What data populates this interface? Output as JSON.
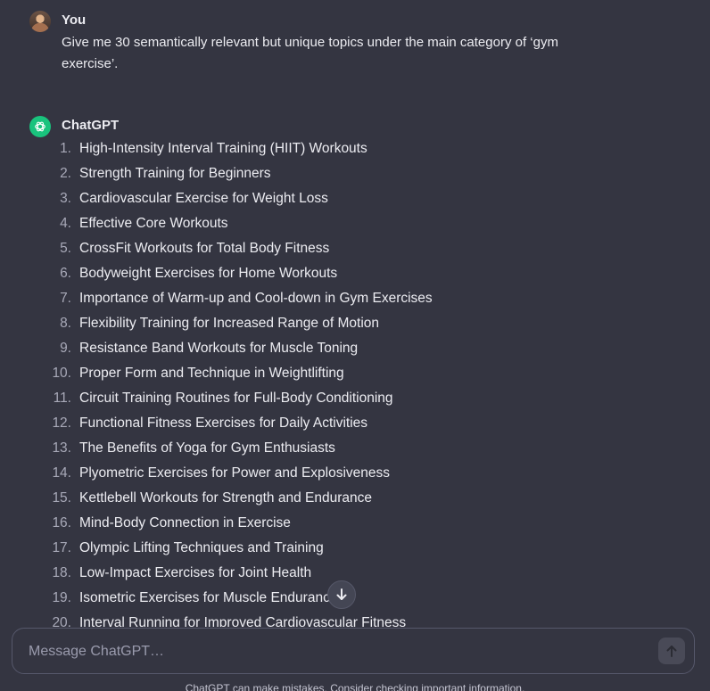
{
  "conversation": {
    "user": {
      "author": "You",
      "message": "Give me 30 semantically relevant but unique topics under the main category of ‘gym exercise’."
    },
    "assistant": {
      "author": "ChatGPT",
      "topics": [
        {
          "num": "1.",
          "text": "High-Intensity Interval Training (HIIT) Workouts"
        },
        {
          "num": "2.",
          "text": "Strength Training for Beginners"
        },
        {
          "num": "3.",
          "text": "Cardiovascular Exercise for Weight Loss"
        },
        {
          "num": "4.",
          "text": "Effective Core Workouts"
        },
        {
          "num": "5.",
          "text": "CrossFit Workouts for Total Body Fitness"
        },
        {
          "num": "6.",
          "text": "Bodyweight Exercises for Home Workouts"
        },
        {
          "num": "7.",
          "text": "Importance of Warm-up and Cool-down in Gym Exercises"
        },
        {
          "num": "8.",
          "text": "Flexibility Training for Increased Range of Motion"
        },
        {
          "num": "9.",
          "text": "Resistance Band Workouts for Muscle Toning"
        },
        {
          "num": "10.",
          "text": "Proper Form and Technique in Weightlifting"
        },
        {
          "num": "11.",
          "text": "Circuit Training Routines for Full-Body Conditioning"
        },
        {
          "num": "12.",
          "text": "Functional Fitness Exercises for Daily Activities"
        },
        {
          "num": "13.",
          "text": "The Benefits of Yoga for Gym Enthusiasts"
        },
        {
          "num": "14.",
          "text": "Plyometric Exercises for Power and Explosiveness"
        },
        {
          "num": "15.",
          "text": "Kettlebell Workouts for Strength and Endurance"
        },
        {
          "num": "16.",
          "text": "Mind-Body Connection in Exercise"
        },
        {
          "num": "17.",
          "text": "Olympic Lifting Techniques and Training"
        },
        {
          "num": "18.",
          "text": "Low-Impact Exercises for Joint Health"
        },
        {
          "num": "19.",
          "text": "Isometric Exercises for Muscle Endurance"
        },
        {
          "num": "20.",
          "text": "Interval Running for Improved Cardiovascular Fitness"
        }
      ]
    }
  },
  "composer": {
    "placeholder": "Message ChatGPT…",
    "send_icon": "arrow-up-icon"
  },
  "scroll_button_icon": "arrow-down-icon",
  "footer": {
    "disclaimer": "ChatGPT can make mistakes. Consider checking important information."
  },
  "colors": {
    "background": "#343541",
    "text": "#ececf1",
    "brand_green": "#19c37d"
  }
}
